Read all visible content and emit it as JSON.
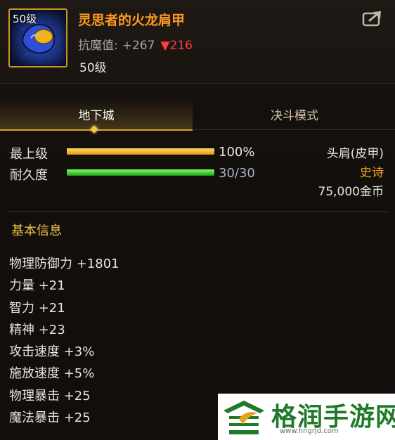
{
  "item": {
    "icon_level": "50级",
    "title": "灵思者的火龙肩甲",
    "resist_label": "抗魔值:",
    "resist_value": "+267",
    "resist_diff": "▼216",
    "level": "50级"
  },
  "tabs": {
    "active": "地下城",
    "inactive": "决斗模式"
  },
  "stats": {
    "max_level_label": "最上级",
    "max_level_value": "100%",
    "max_level_fraction": 1.0,
    "durability_label": "耐久度",
    "durability_value": "30/30",
    "durability_fraction": 1.0
  },
  "info": {
    "slot": "头肩(皮甲)",
    "rarity": "史诗",
    "price": "75,000金币"
  },
  "section_title": "基本信息",
  "attributes": [
    "物理防御力 +1801",
    "力量 +21",
    "智力 +21",
    "精神 +23",
    "攻击速度 +3%",
    "施放速度 +5%",
    "物理暴击 +25",
    "魔法暴击 +25"
  ],
  "watermark": {
    "title": "格润手游网",
    "url": "www.hngrjd.com"
  },
  "colors": {
    "title": "#ff9a1f",
    "rarity": "#f0a020",
    "section": "#f0c44a",
    "diff": "#ff3b3b",
    "tab_accent": "#d8a12a"
  }
}
